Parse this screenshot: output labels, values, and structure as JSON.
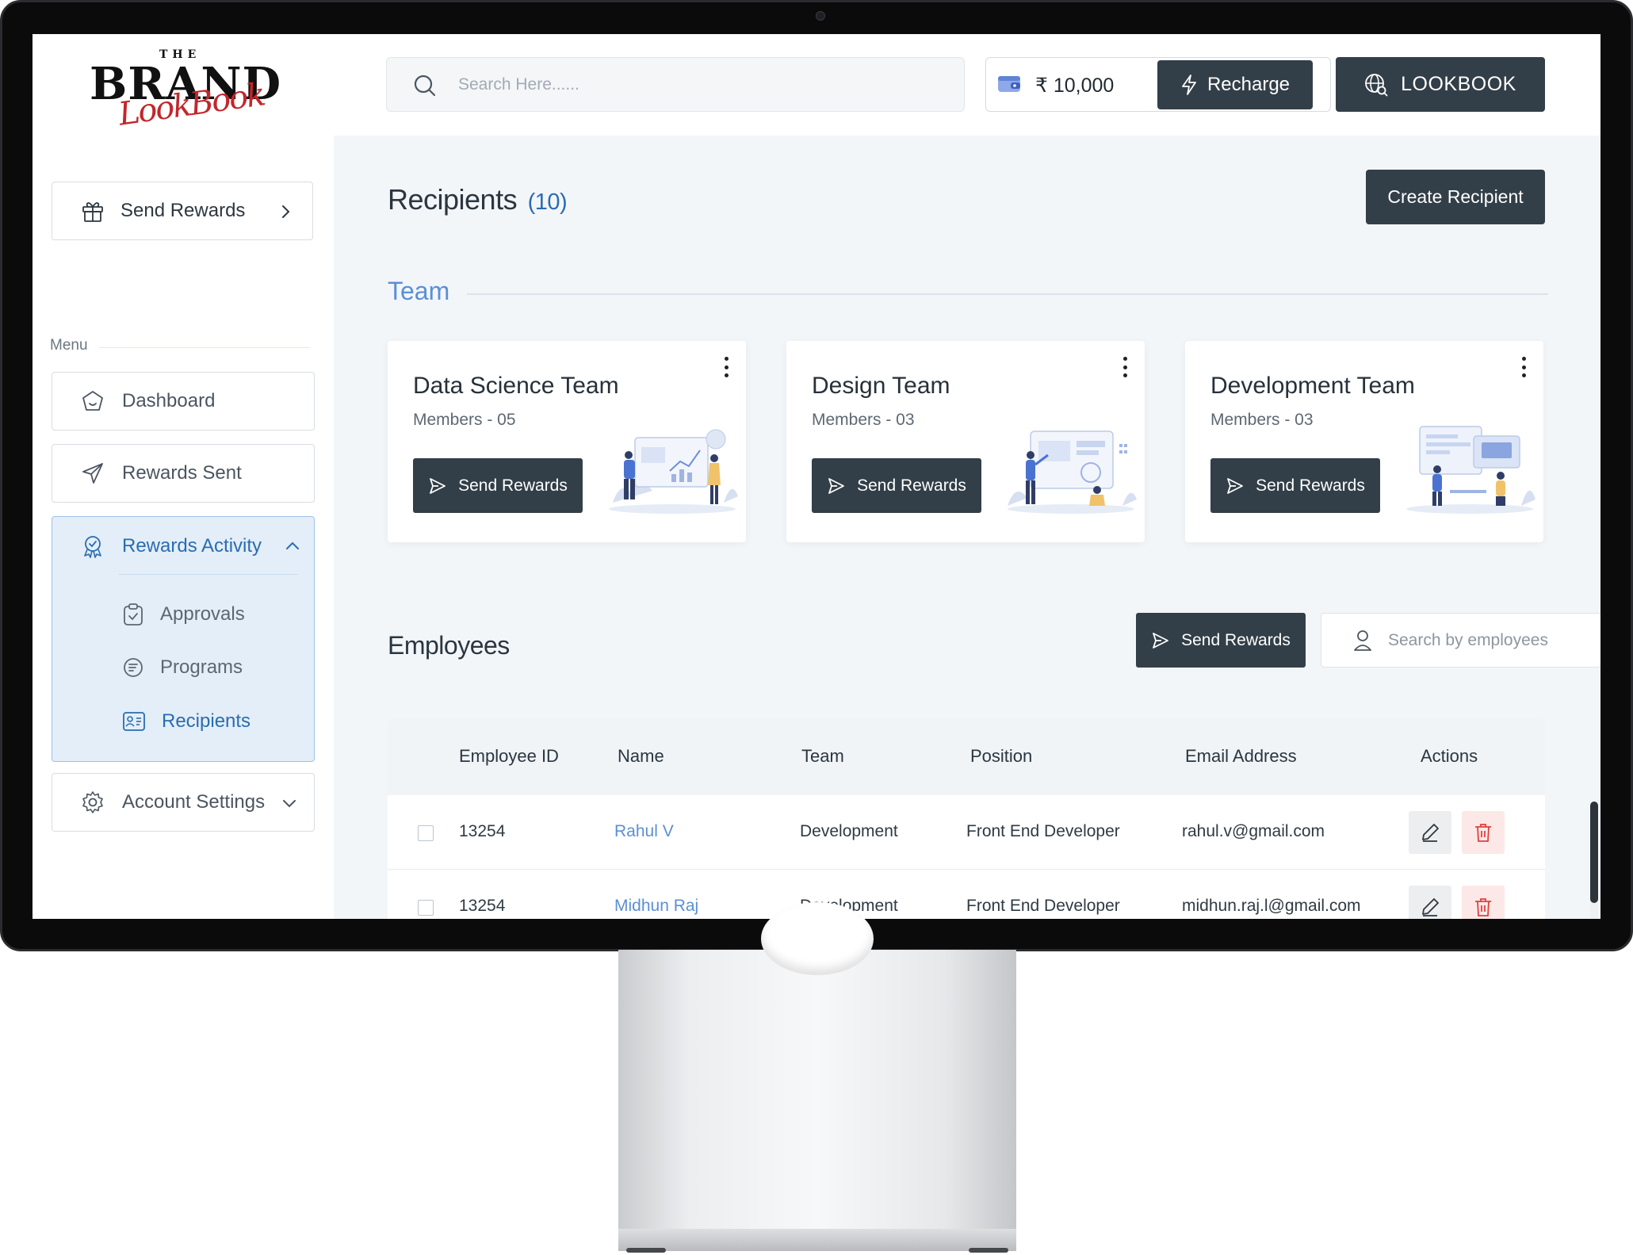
{
  "brand": {
    "the": "THE",
    "name": "BRAND",
    "script": "LookBook"
  },
  "search": {
    "placeholder": "Search Here......"
  },
  "wallet": {
    "amount": "₹ 10,000",
    "recharge_label": "Recharge"
  },
  "lookbook_label": "LOOKBOOK",
  "sidebar": {
    "send_rewards": "Send Rewards",
    "menu_label": "Menu",
    "items": [
      {
        "label": "Dashboard",
        "icon": "dashboard-icon"
      },
      {
        "label": "Rewards Sent",
        "icon": "paper-plane-icon"
      },
      {
        "label": "Rewards Activity",
        "icon": "badge-icon",
        "expanded": true,
        "children": [
          {
            "label": "Approvals",
            "icon": "clipboard-check-icon"
          },
          {
            "label": "Programs",
            "icon": "programs-icon"
          },
          {
            "label": "Recipients",
            "icon": "id-card-icon",
            "active": true
          }
        ]
      },
      {
        "label": "Account Settings",
        "icon": "gear-icon"
      }
    ]
  },
  "main": {
    "title": "Recipients",
    "count": "(10)",
    "create_label": "Create Recipient",
    "team_heading": "Team",
    "teams": [
      {
        "name": "Data Science Team",
        "members": "Members - 05",
        "button": "Send Rewards"
      },
      {
        "name": "Design Team",
        "members": "Members - 03",
        "button": "Send Rewards"
      },
      {
        "name": "Development Team",
        "members": "Members - 03",
        "button": "Send Rewards"
      }
    ],
    "employees_heading": "Employees",
    "employees_send": "Send Rewards",
    "employee_search_placeholder": "Search by employees",
    "table": {
      "columns": [
        "Employee ID",
        "Name",
        "Team",
        "Position",
        "Email Address",
        "Actions"
      ],
      "rows": [
        {
          "id": "13254",
          "name": "Rahul V",
          "team": "Development",
          "position": "Front End Developer",
          "email": "rahul.v@gmail.com"
        },
        {
          "id": "13254",
          "name": "Midhun Raj",
          "team": "Development",
          "position": "Front End Developer",
          "email": "midhun.raj.l@gmail.com"
        }
      ]
    }
  },
  "colors": {
    "dark": "#333f48",
    "accent_blue": "#2b6cb0",
    "link_blue": "#5b8fd6",
    "delete_red": "#e0403a",
    "brand_red": "#c1272d"
  }
}
